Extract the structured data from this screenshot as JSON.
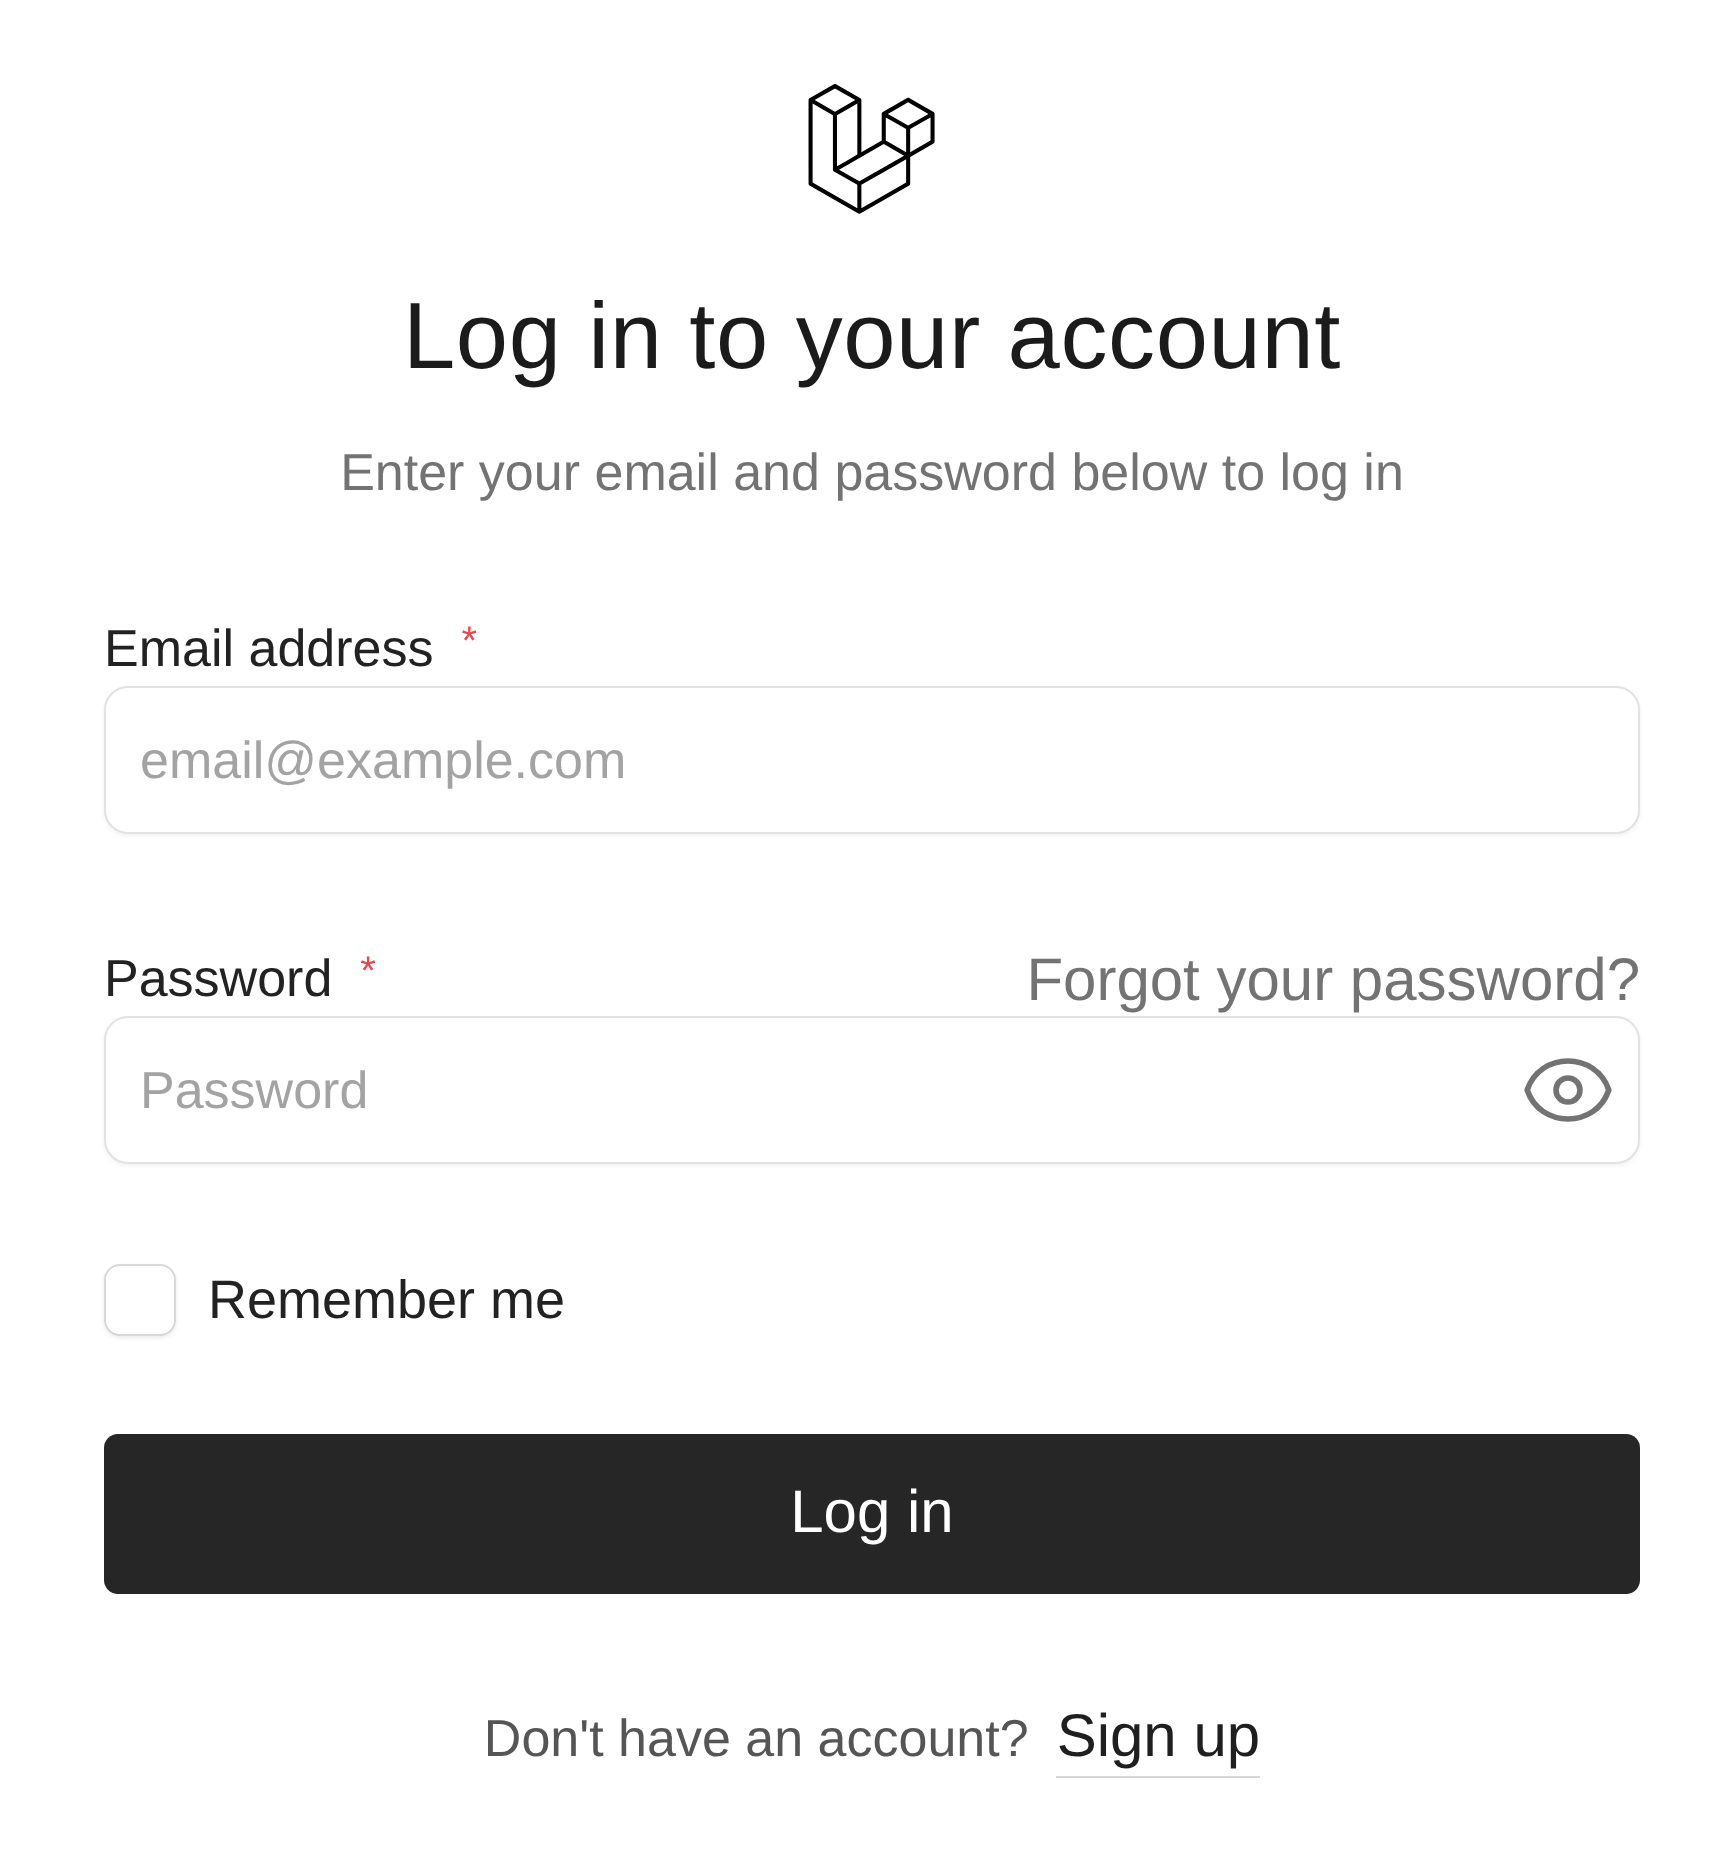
{
  "header": {
    "title": "Log in to your account",
    "subtitle": "Enter your email and password below to log in"
  },
  "form": {
    "fields": [
      {
        "kind": "email",
        "label": "Email address",
        "required_mark": "*",
        "placeholder": "email@example.com"
      },
      {
        "kind": "password",
        "label": "Password",
        "required_mark": "*",
        "placeholder": "Password",
        "link": "Forgot your password?"
      }
    ],
    "remember": {
      "label": "Remember me",
      "checked": false
    },
    "submit": {
      "label": "Log in"
    }
  },
  "footer": {
    "text": "Don't have an account?",
    "link": "Sign up"
  }
}
